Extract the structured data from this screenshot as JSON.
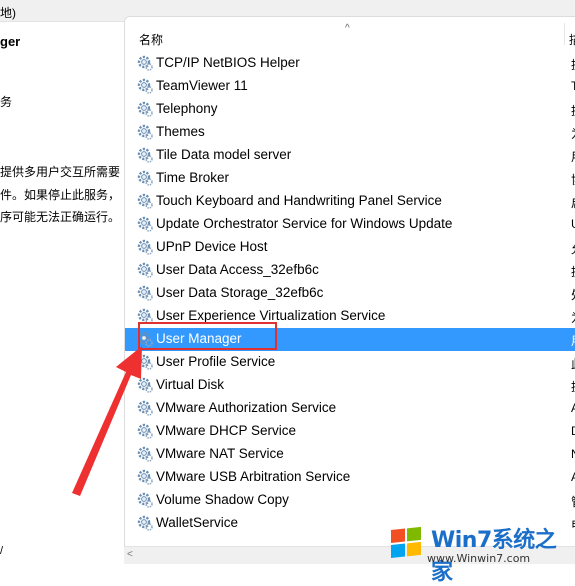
{
  "window": {
    "title_fragment": "地)"
  },
  "left_pane": {
    "service_name_fragment": "ger",
    "line_fragment": "务",
    "description_lines": [
      "提供多用户交互所需要",
      "件。如果停止此服务，",
      "序可能无法正确运行。"
    ],
    "bottom_fragment": "/"
  },
  "list": {
    "header": {
      "name_label": "名称",
      "col2_label": "描"
    },
    "rows": [
      {
        "name": "TCP/IP NetBIOS Helper",
        "col2": "提"
      },
      {
        "name": "TeamViewer 11",
        "col2": "T"
      },
      {
        "name": "Telephony",
        "col2": "提"
      },
      {
        "name": "Themes",
        "col2": "为"
      },
      {
        "name": "Tile Data model server",
        "col2": "用"
      },
      {
        "name": "Time Broker",
        "col2": "协"
      },
      {
        "name": "Touch Keyboard and Handwriting Panel Service",
        "col2": "启"
      },
      {
        "name": "Update Orchestrator Service for Windows Update",
        "col2": "U"
      },
      {
        "name": "UPnP Device Host",
        "col2": "允"
      },
      {
        "name": "User Data Access_32efb6c",
        "col2": "提"
      },
      {
        "name": "User Data Storage_32efb6c",
        "col2": "处"
      },
      {
        "name": "User Experience Virtualization Service",
        "col2": "为"
      },
      {
        "name": "User Manager",
        "col2": "用"
      },
      {
        "name": "User Profile Service",
        "col2": "此"
      },
      {
        "name": "Virtual Disk",
        "col2": "提"
      },
      {
        "name": "VMware Authorization Service",
        "col2": "A"
      },
      {
        "name": "VMware DHCP Service",
        "col2": "D"
      },
      {
        "name": "VMware NAT Service",
        "col2": "N"
      },
      {
        "name": "VMware USB Arbitration Service",
        "col2": "A"
      },
      {
        "name": "Volume Shadow Copy",
        "col2": "管"
      },
      {
        "name": "WalletService",
        "col2": "电"
      }
    ],
    "selected_index": 12
  },
  "watermark": {
    "brand": "Win7系统之家",
    "url": "www.Winwin7.com"
  },
  "colors": {
    "selection": "#3399ff",
    "annotation": "#e03030",
    "gear": "#6a8fb3"
  }
}
